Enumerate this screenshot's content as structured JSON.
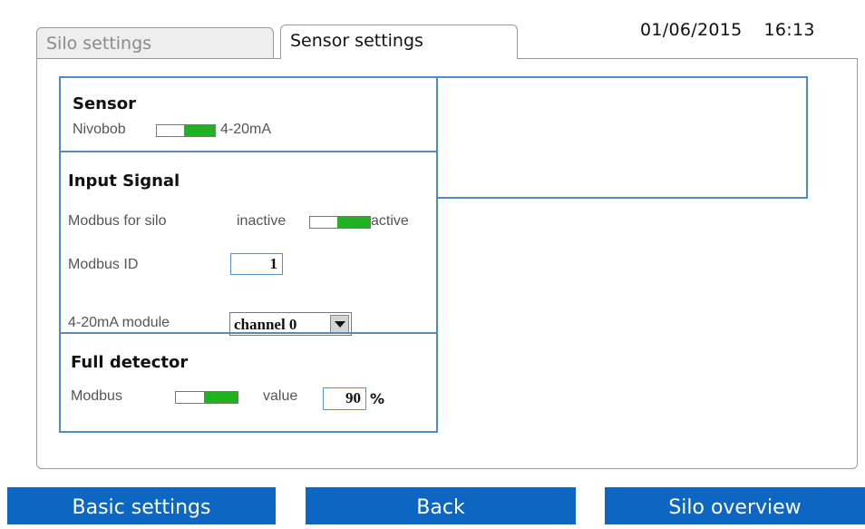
{
  "tabs": {
    "silo_settings": "Silo settings",
    "sensor_settings": "Sensor settings"
  },
  "datetime": {
    "date": "01/06/2015",
    "time": "16:13"
  },
  "sensor": {
    "title": "Sensor",
    "left_label": "Nivobob",
    "right_label": "4-20mA",
    "toggle_state": "right"
  },
  "input_signal": {
    "title": "Input Signal",
    "modbus_for_silo": {
      "label": "Modbus for silo",
      "off_label": "inactive",
      "on_label": "active",
      "toggle_state": "right"
    },
    "modbus_id": {
      "label": "Modbus ID",
      "value": "1"
    },
    "module": {
      "label": "4-20mA module",
      "selected": "channel 0"
    }
  },
  "full_detector": {
    "title": "Full detector",
    "left_label": "Modbus",
    "right_label": "value",
    "toggle_state": "right",
    "value": "90",
    "unit": "%"
  },
  "buttons": {
    "basic_settings": "Basic settings",
    "back": "Back",
    "silo_overview": "Silo overview"
  },
  "colors": {
    "accent_blue": "#0d66c2",
    "border_blue": "#4f8ac9",
    "toggle_green": "#1fb41f"
  }
}
